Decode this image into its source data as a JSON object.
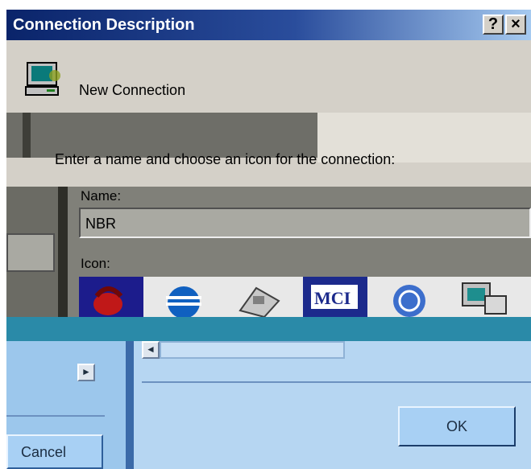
{
  "window": {
    "title": "Connection Description",
    "help_label": "?",
    "close_label": "×"
  },
  "header": {
    "connection_name": "New Connection"
  },
  "instructions": "Enter a name and choose an icon for the connection:",
  "form": {
    "name_label": "Name:",
    "name_value": "NBR",
    "icon_label": "Icon:"
  },
  "icons": [
    {
      "name": "phone-icon"
    },
    {
      "name": "globe-icon"
    },
    {
      "name": "fax-phone-icon"
    },
    {
      "name": "mci-icon",
      "text": "MCI"
    },
    {
      "name": "att-globe-icon"
    },
    {
      "name": "computer-phone-icon"
    }
  ],
  "scrollbar": {
    "left_arrow": "◄",
    "right_arrow": "►"
  },
  "buttons": {
    "ok": "OK",
    "cancel": "Cancel"
  },
  "colors": {
    "titlebar_start": "#0a246a",
    "titlebar_end": "#a6caf0",
    "dialog_face": "#d4d0c8"
  }
}
